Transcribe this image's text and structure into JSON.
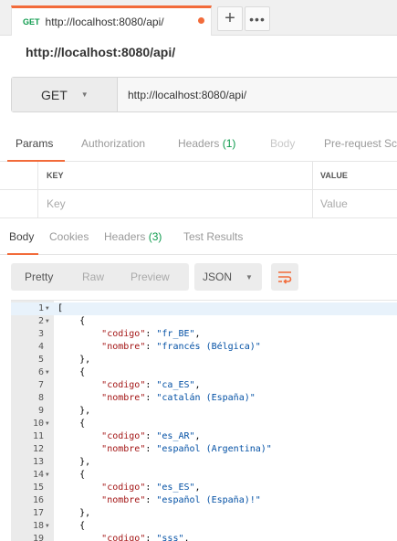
{
  "tab": {
    "method": "GET",
    "title": "http://localhost:8080/api/"
  },
  "tab_controls": {
    "add": "+",
    "more": "•••"
  },
  "request_name": "http://localhost:8080/api/",
  "url_bar": {
    "method": "GET",
    "url": "http://localhost:8080/api/"
  },
  "request_tabs": [
    {
      "label": "Params",
      "count": ""
    },
    {
      "label": "Authorization",
      "count": ""
    },
    {
      "label": "Headers",
      "count": "(1)"
    },
    {
      "label": "Body",
      "count": ""
    },
    {
      "label": "Pre-request Sc",
      "count": ""
    }
  ],
  "params_table": {
    "headers": {
      "key": "KEY",
      "value": "VALUE"
    },
    "placeholders": {
      "key": "Key",
      "value": "Value"
    }
  },
  "response_tabs": [
    {
      "label": "Body",
      "count": ""
    },
    {
      "label": "Cookies",
      "count": ""
    },
    {
      "label": "Headers",
      "count": "(3)"
    },
    {
      "label": "Test Results",
      "count": ""
    }
  ],
  "body_toolbar": {
    "pretty": "Pretty",
    "raw": "Raw",
    "preview": "Preview",
    "format": "JSON"
  },
  "code_lines": [
    {
      "n": "1",
      "fold": true,
      "i": "",
      "t": "bracket",
      "v": "["
    },
    {
      "n": "2",
      "fold": true,
      "i": "    ",
      "t": "bracket",
      "v": "{"
    },
    {
      "n": "3",
      "fold": false,
      "i": "        ",
      "t": "kv",
      "k": "\"codigo\"",
      "s": "\"fr_BE\"",
      "c": ","
    },
    {
      "n": "4",
      "fold": false,
      "i": "        ",
      "t": "kv",
      "k": "\"nombre\"",
      "s": "\"francés (Bélgica)\"",
      "c": ""
    },
    {
      "n": "5",
      "fold": false,
      "i": "    ",
      "t": "bracket",
      "v": "},"
    },
    {
      "n": "6",
      "fold": true,
      "i": "    ",
      "t": "bracket",
      "v": "{"
    },
    {
      "n": "7",
      "fold": false,
      "i": "        ",
      "t": "kv",
      "k": "\"codigo\"",
      "s": "\"ca_ES\"",
      "c": ","
    },
    {
      "n": "8",
      "fold": false,
      "i": "        ",
      "t": "kv",
      "k": "\"nombre\"",
      "s": "\"catalán (España)\"",
      "c": ""
    },
    {
      "n": "9",
      "fold": false,
      "i": "    ",
      "t": "bracket",
      "v": "},"
    },
    {
      "n": "10",
      "fold": true,
      "i": "    ",
      "t": "bracket",
      "v": "{"
    },
    {
      "n": "11",
      "fold": false,
      "i": "        ",
      "t": "kv",
      "k": "\"codigo\"",
      "s": "\"es_AR\"",
      "c": ","
    },
    {
      "n": "12",
      "fold": false,
      "i": "        ",
      "t": "kv",
      "k": "\"nombre\"",
      "s": "\"español (Argentina)\"",
      "c": ""
    },
    {
      "n": "13",
      "fold": false,
      "i": "    ",
      "t": "bracket",
      "v": "},"
    },
    {
      "n": "14",
      "fold": true,
      "i": "    ",
      "t": "bracket",
      "v": "{"
    },
    {
      "n": "15",
      "fold": false,
      "i": "        ",
      "t": "kv",
      "k": "\"codigo\"",
      "s": "\"es_ES\"",
      "c": ","
    },
    {
      "n": "16",
      "fold": false,
      "i": "        ",
      "t": "kv",
      "k": "\"nombre\"",
      "s": "\"español (España)!\"",
      "c": ""
    },
    {
      "n": "17",
      "fold": false,
      "i": "    ",
      "t": "bracket",
      "v": "},"
    },
    {
      "n": "18",
      "fold": true,
      "i": "    ",
      "t": "bracket",
      "v": "{"
    },
    {
      "n": "19",
      "fold": false,
      "i": "        ",
      "t": "kv",
      "k": "\"codigo\"",
      "s": "\"sss\"",
      "c": ","
    }
  ],
  "colors": {
    "accent": "#f26b3a",
    "get_method": "#0d9b4d",
    "json_key": "#a31515",
    "json_string": "#0451a5"
  },
  "icons": {
    "fold": "caret-down-icon",
    "wrap": "wrap-lines-icon",
    "dropdown": "caret-down-icon"
  }
}
